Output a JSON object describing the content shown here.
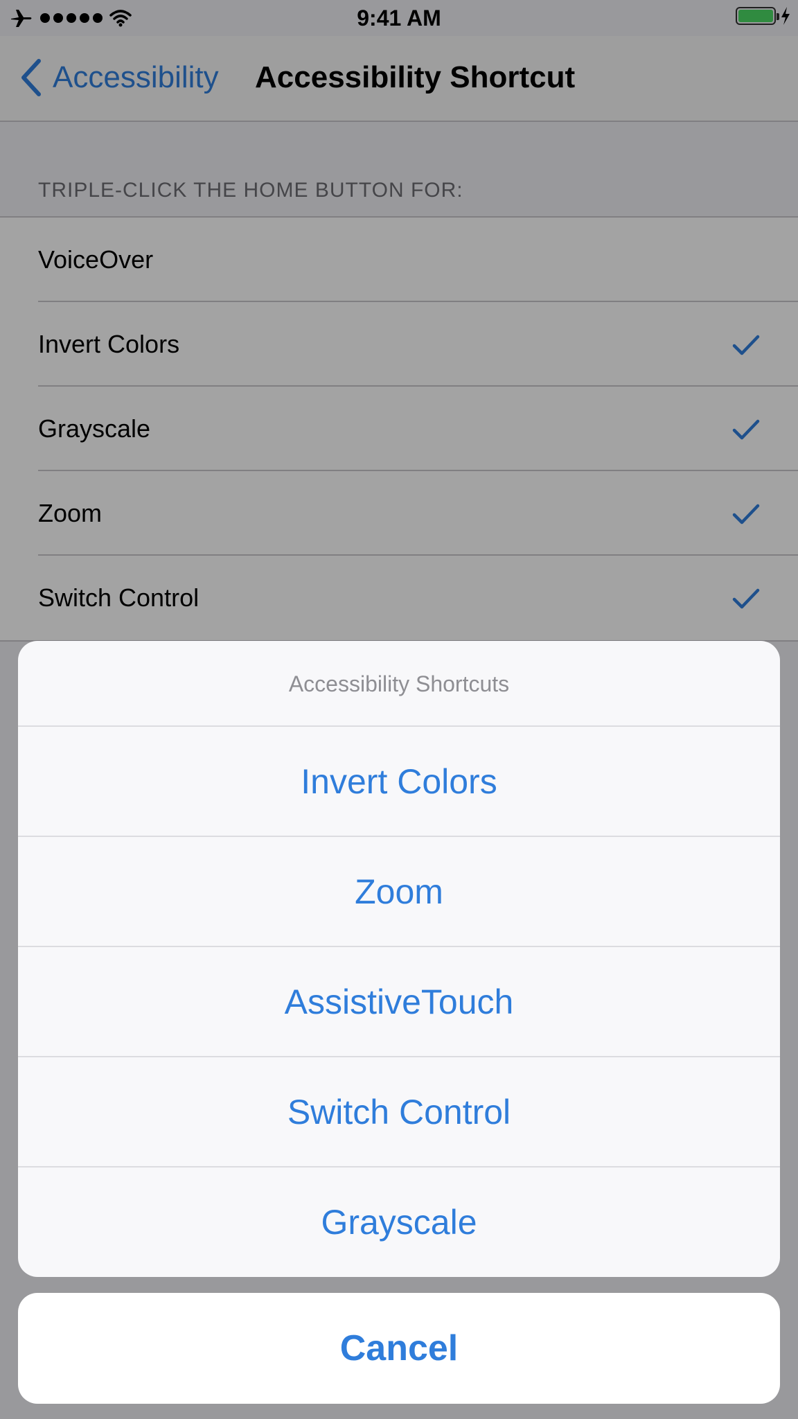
{
  "status_bar": {
    "time": "9:41 AM",
    "airplane_icon": "airplane-icon",
    "wifi_icon": "wifi-icon",
    "battery_icon": "battery-icon",
    "charging_icon": "bolt-icon"
  },
  "nav": {
    "back_label": "Accessibility",
    "title": "Accessibility Shortcut"
  },
  "settings": {
    "section_header": "TRIPLE-CLICK THE HOME BUTTON FOR:",
    "items": [
      {
        "label": "VoiceOver",
        "checked": false
      },
      {
        "label": "Invert Colors",
        "checked": true
      },
      {
        "label": "Grayscale",
        "checked": true
      },
      {
        "label": "Zoom",
        "checked": true
      },
      {
        "label": "Switch Control",
        "checked": true
      }
    ]
  },
  "action_sheet": {
    "title": "Accessibility Shortcuts",
    "options": [
      {
        "label": "Invert Colors"
      },
      {
        "label": "Zoom"
      },
      {
        "label": "AssistiveTouch"
      },
      {
        "label": "Switch Control"
      },
      {
        "label": "Grayscale"
      }
    ],
    "cancel_label": "Cancel"
  },
  "colors": {
    "accent": "#2f7ddb",
    "battery": "#4cd964",
    "separator": "#c8c7cc"
  }
}
